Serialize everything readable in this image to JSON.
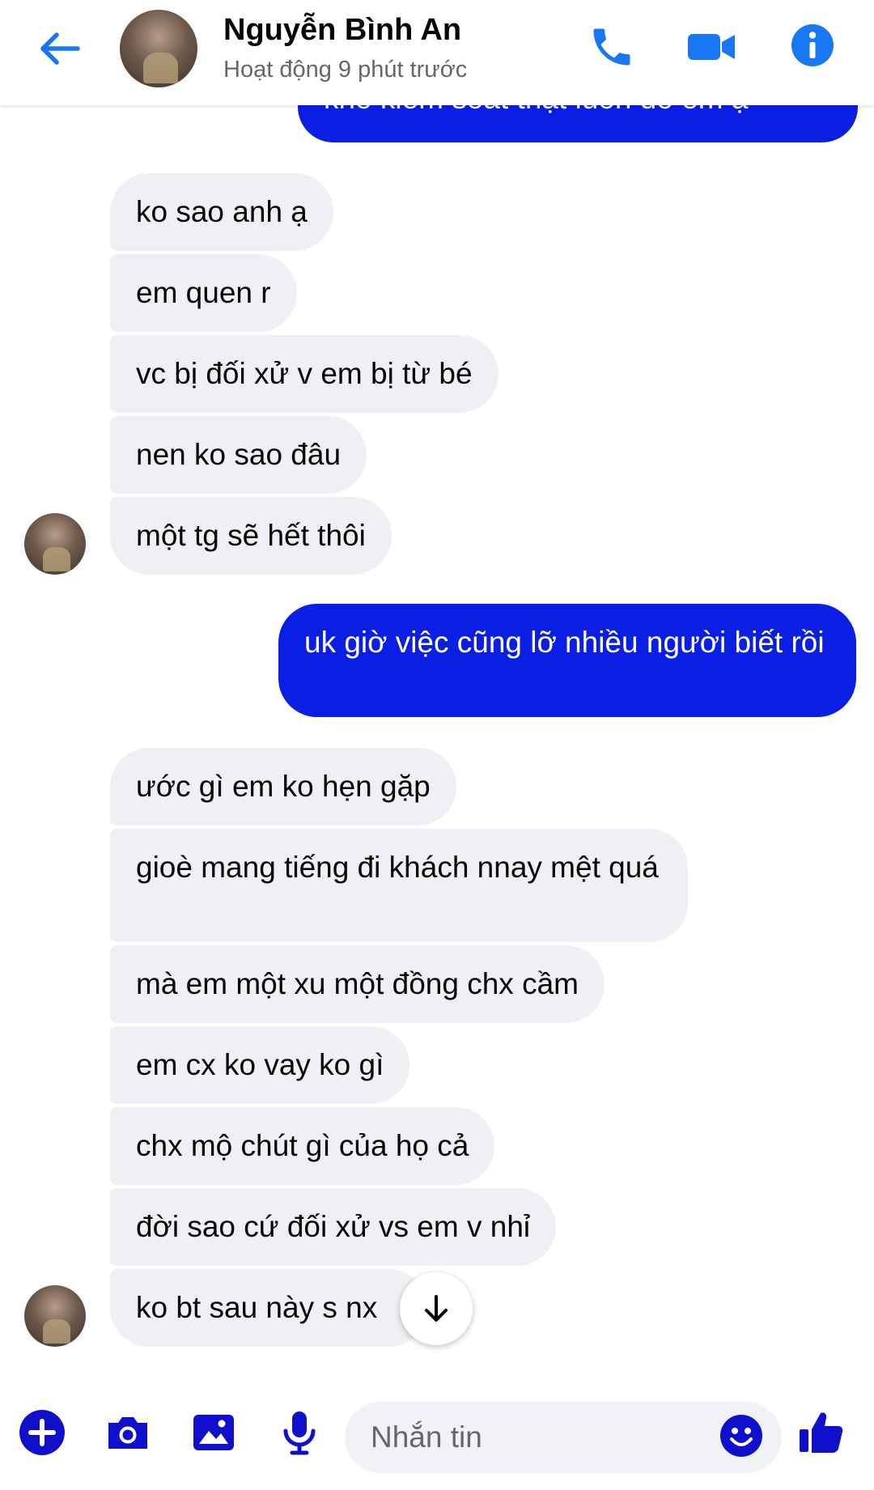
{
  "header": {
    "contact_name": "Nguyễn Bình An",
    "status": "Hoạt động 9 phút trước"
  },
  "messages": [
    {
      "from": "me",
      "text": "khó kiểm soát thật luôn đó em ạ"
    },
    {
      "from": "them",
      "text": "ko sao anh ạ"
    },
    {
      "from": "them",
      "text": "em quen r"
    },
    {
      "from": "them",
      "text": "vc bị đối xử v em bị từ bé"
    },
    {
      "from": "them",
      "text": "nen ko sao đâu"
    },
    {
      "from": "them",
      "text": "một tg sẽ hết thôi"
    },
    {
      "from": "me",
      "text": "uk giờ việc cũng lỡ nhiều người biết rồi"
    },
    {
      "from": "them",
      "text": "ước gì em ko hẹn gặp"
    },
    {
      "from": "them",
      "text": "gioè mang tiếng đi khách nnay mệt quá"
    },
    {
      "from": "them",
      "text": "mà em một xu một đồng chx cầm"
    },
    {
      "from": "them",
      "text": "em cx ko vay ko gì"
    },
    {
      "from": "them",
      "text": "chx mộ chút gì của họ cả"
    },
    {
      "from": "them",
      "text": "đời sao cứ đối xử vs em v nhỉ"
    },
    {
      "from": "them",
      "text": "ko bt sau này s nx"
    }
  ],
  "composer": {
    "placeholder": "Nhắn tin"
  },
  "colors": {
    "accent": "#1877f2",
    "outgoing_bubble": "#0a1fe3",
    "incoming_bubble": "#f0f0f4",
    "composer_icons": "#1010cc"
  },
  "icons": {
    "back": "arrow-left-icon",
    "call": "phone-icon",
    "video": "video-camera-icon",
    "info": "info-icon",
    "scroll_down": "arrow-down-icon",
    "plus": "plus-icon",
    "camera": "camera-icon",
    "image": "image-icon",
    "mic": "microphone-icon",
    "emoji": "emoji-icon",
    "like": "thumbs-up-icon"
  }
}
